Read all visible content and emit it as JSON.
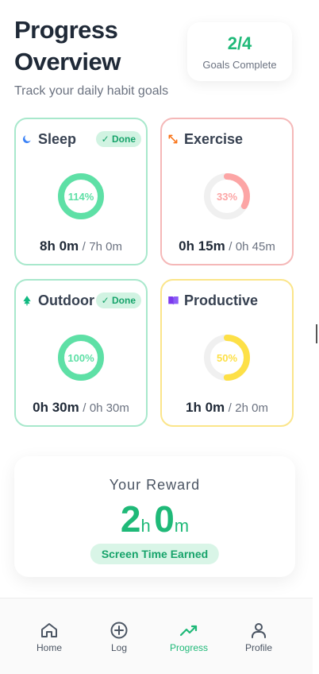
{
  "header": {
    "title": "Progress Overview",
    "subtitle": "Track your daily habit goals"
  },
  "goals_summary": {
    "value": "2/4",
    "label": "Goals Complete"
  },
  "habits": [
    {
      "name": "Sleep",
      "icon": "moon-icon",
      "done": true,
      "done_label": "✓ Done",
      "percent_label": "114%",
      "progress": 1.14,
      "time": "8h 0m",
      "separator": "/",
      "goal": "7h 0m",
      "color": "#5ee0a6",
      "border": "#a8e8cc",
      "icon_color": "#3b82f6"
    },
    {
      "name": "Exercise",
      "icon": "arrows-expand-icon",
      "done": false,
      "percent_label": "33%",
      "progress": 0.33,
      "time": "0h 15m",
      "separator": "/",
      "goal": "0h 45m",
      "color": "#fca5a5",
      "border": "#f5b8b8",
      "icon_color": "#f97316"
    },
    {
      "name": "Outdoor",
      "icon": "tree-icon",
      "done": true,
      "done_label": "✓ Done",
      "percent_label": "100%",
      "progress": 1.0,
      "time": "0h 30m",
      "separator": "/",
      "goal": "0h 30m",
      "color": "#5ee0a6",
      "border": "#a8e8cc",
      "icon_color": "#10b981"
    },
    {
      "name": "Productive",
      "icon": "book-icon",
      "done": false,
      "percent_label": "50%",
      "progress": 0.5,
      "time": "1h 0m",
      "separator": "/",
      "goal": "2h 0m",
      "color": "#fde047",
      "border": "#fbe58a",
      "icon_color": "#7c3aed"
    }
  ],
  "reward": {
    "title": "Your Reward",
    "hours": "2",
    "hours_unit": "h",
    "minutes": "0",
    "minutes_unit": "m",
    "badge": "Screen Time Earned"
  },
  "nav": {
    "items": [
      {
        "label": "Home",
        "icon": "home-icon",
        "active": false
      },
      {
        "label": "Log",
        "icon": "plus-circle-icon",
        "active": false
      },
      {
        "label": "Progress",
        "icon": "trending-icon",
        "active": true
      },
      {
        "label": "Profile",
        "icon": "user-icon",
        "active": false
      }
    ]
  },
  "colors": {
    "accent": "#1fb978",
    "text_primary": "#1f2937",
    "text_secondary": "#6b7280"
  }
}
